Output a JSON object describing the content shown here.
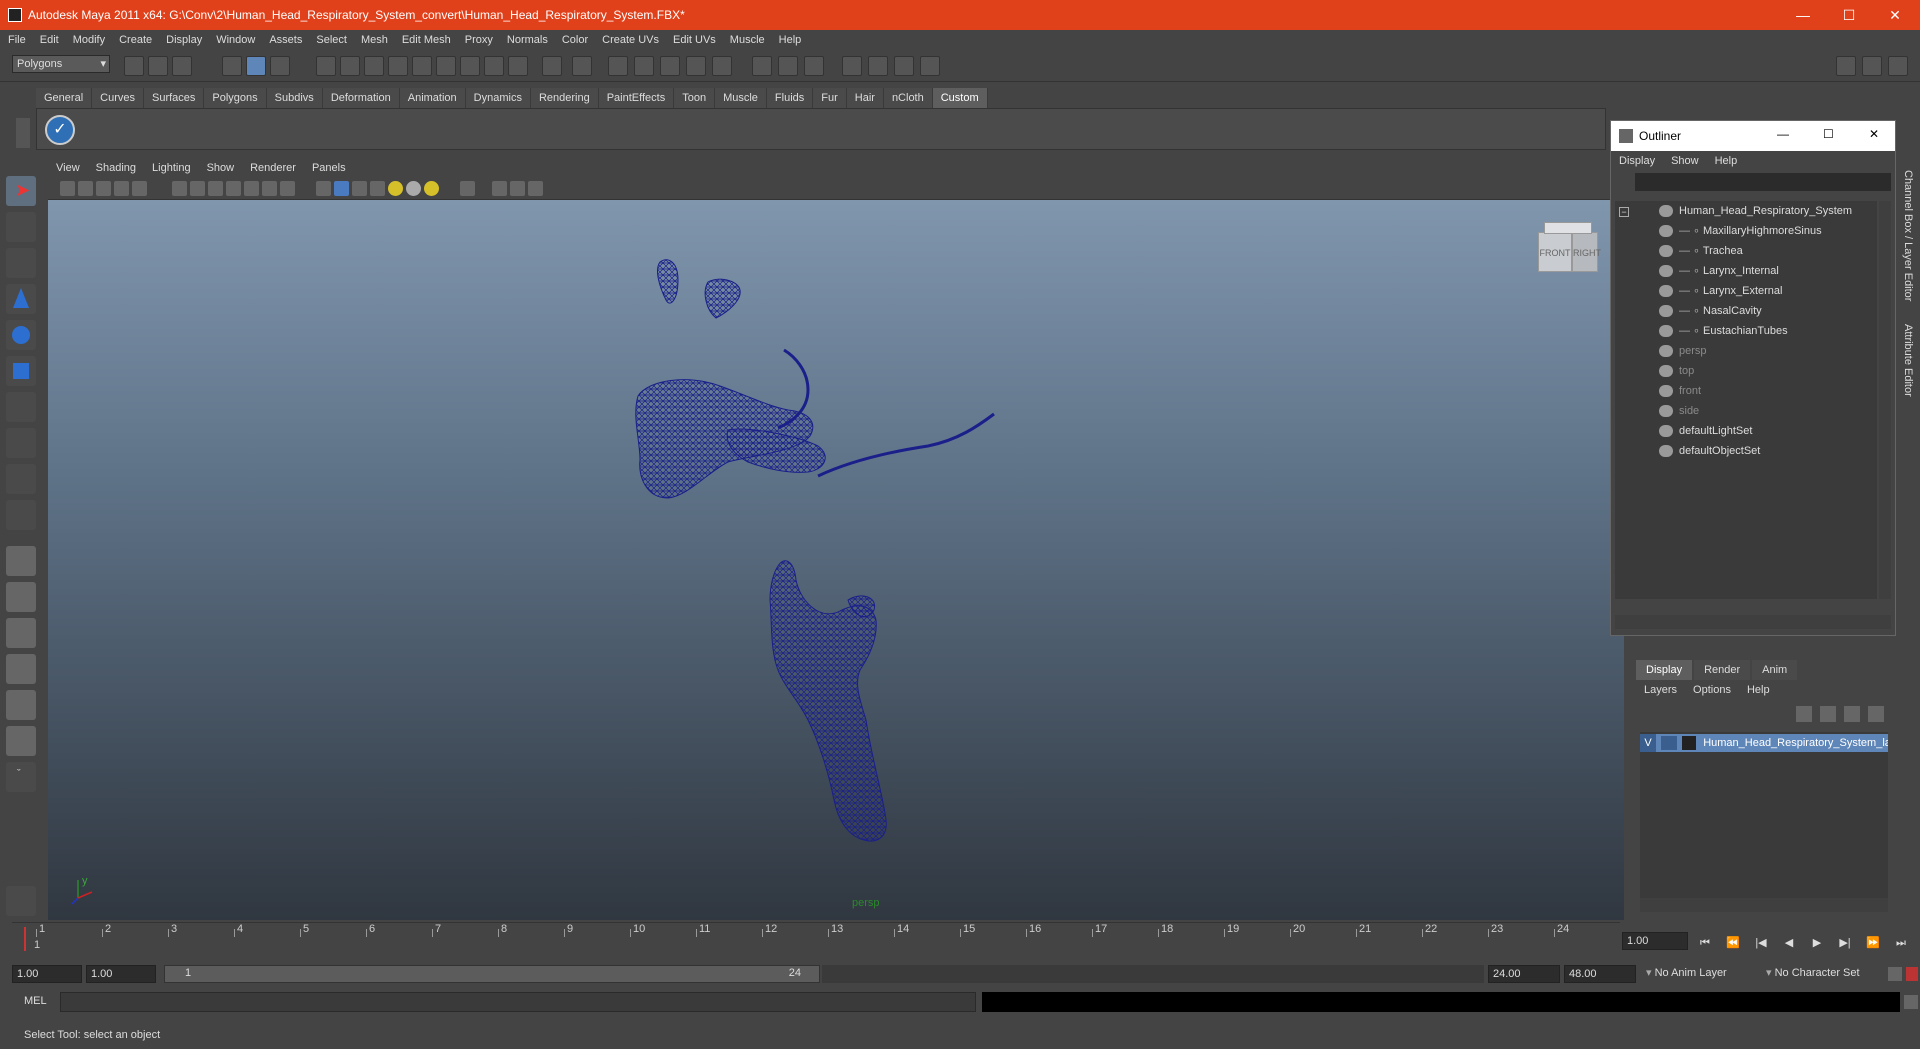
{
  "window": {
    "title": "Autodesk Maya 2011 x64: G:\\Conv\\2\\Human_Head_Respiratory_System_convert\\Human_Head_Respiratory_System.FBX*",
    "minimize": "—",
    "maximize": "☐",
    "close": "✕"
  },
  "menubar": [
    "File",
    "Edit",
    "Modify",
    "Create",
    "Display",
    "Window",
    "Assets",
    "Select",
    "Mesh",
    "Edit Mesh",
    "Proxy",
    "Normals",
    "Color",
    "Create UVs",
    "Edit UVs",
    "Muscle",
    "Help"
  ],
  "status_line": {
    "mode_dropdown": "Polygons"
  },
  "shelf_tabs": [
    "General",
    "Curves",
    "Surfaces",
    "Polygons",
    "Subdivs",
    "Deformation",
    "Animation",
    "Dynamics",
    "Rendering",
    "PaintEffects",
    "Toon",
    "Muscle",
    "Fluids",
    "Fur",
    "Hair",
    "nCloth",
    "Custom"
  ],
  "shelf_active": "Custom",
  "panel_menu": [
    "View",
    "Shading",
    "Lighting",
    "Show",
    "Renderer",
    "Panels"
  ],
  "viewport": {
    "camera_label": "persp",
    "viewcube_front": "FRONT",
    "viewcube_right": "RIGHT",
    "axis_y": "y",
    "axis_x": "x",
    "wire_color": "#1a1f8a"
  },
  "outliner": {
    "title": "Outliner",
    "menu": [
      "Display",
      "Show",
      "Help"
    ],
    "items": [
      {
        "label": "Human_Head_Respiratory_System",
        "dim": false,
        "indent": 0
      },
      {
        "label": "MaxillaryHighmoreSinus",
        "dim": false,
        "indent": 1
      },
      {
        "label": "Trachea",
        "dim": false,
        "indent": 1
      },
      {
        "label": "Larynx_Internal",
        "dim": false,
        "indent": 1
      },
      {
        "label": "Larynx_External",
        "dim": false,
        "indent": 1
      },
      {
        "label": "NasalCavity",
        "dim": false,
        "indent": 1
      },
      {
        "label": "EustachianTubes",
        "dim": false,
        "indent": 1
      },
      {
        "label": "persp",
        "dim": true,
        "indent": 0
      },
      {
        "label": "top",
        "dim": true,
        "indent": 0
      },
      {
        "label": "front",
        "dim": true,
        "indent": 0
      },
      {
        "label": "side",
        "dim": true,
        "indent": 0
      },
      {
        "label": "defaultLightSet",
        "dim": false,
        "indent": 0
      },
      {
        "label": "defaultObjectSet",
        "dim": false,
        "indent": 0
      }
    ]
  },
  "side_tabs": {
    "channel_box": "Channel Box / Layer Editor",
    "attribute_editor": "Attribute Editor"
  },
  "layer_editor": {
    "tabs": [
      "Display",
      "Render",
      "Anim"
    ],
    "active_tab": "Display",
    "menu": [
      "Layers",
      "Options",
      "Help"
    ],
    "layer_visibility": "V",
    "layer_name": "Human_Head_Respiratory_System_la"
  },
  "time_slider": {
    "ticks": [
      "1",
      "2",
      "3",
      "4",
      "5",
      "6",
      "7",
      "8",
      "9",
      "10",
      "11",
      "12",
      "13",
      "14",
      "15",
      "16",
      "17",
      "18",
      "19",
      "20",
      "21",
      "22",
      "23",
      "24"
    ],
    "current_frame": "1",
    "current_time_field": "1.00"
  },
  "range_slider": {
    "start_time": "1.00",
    "playback_start": "1.00",
    "range_start_label": "1",
    "range_end_label": "24",
    "playback_end": "24.00",
    "end_time": "48.00",
    "anim_layer": "No Anim Layer",
    "character_set": "No Character Set"
  },
  "command_line": {
    "label": "MEL"
  },
  "help_line": "Select Tool: select an object"
}
